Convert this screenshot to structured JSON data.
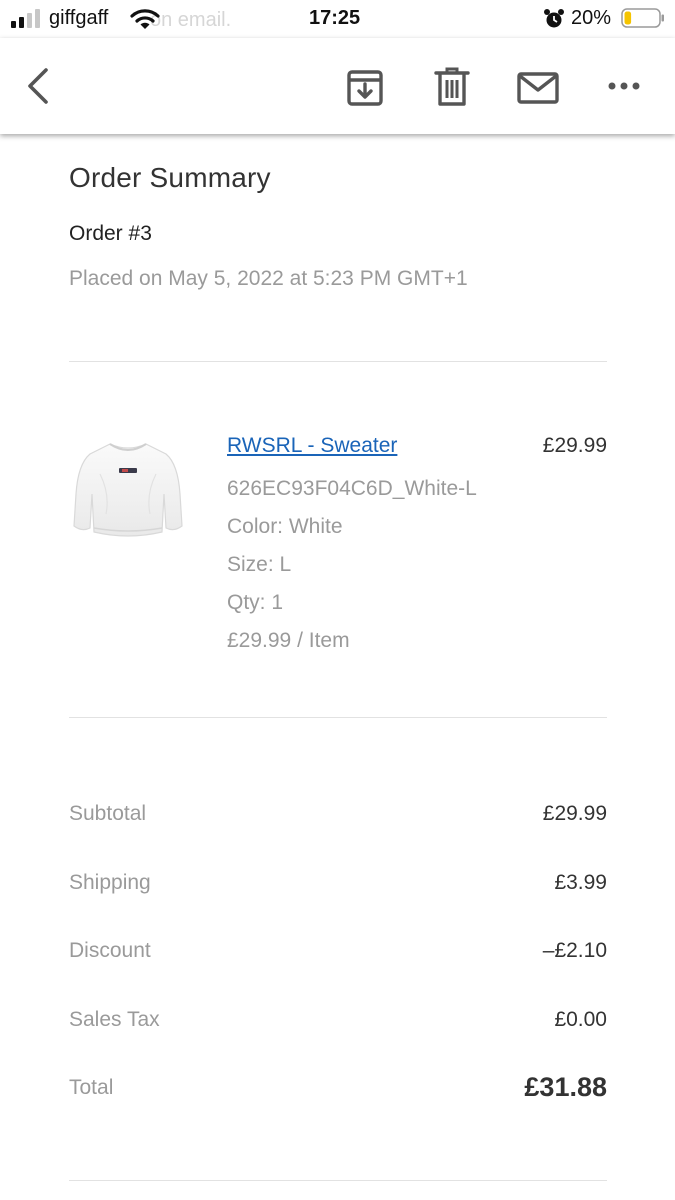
{
  "status_bar": {
    "carrier": "giffgaff",
    "ghost_text": "on email.",
    "time": "17:25",
    "battery_percent": "20%",
    "battery_level": 0.2,
    "signal_bars": 2,
    "icons": [
      "signal-icon",
      "wifi-icon",
      "alarm-icon",
      "battery-icon"
    ]
  },
  "toolbar": {
    "icons": [
      "back-icon",
      "archive-icon",
      "trash-icon",
      "mail-icon",
      "more-icon"
    ]
  },
  "order": {
    "title": "Order Summary",
    "number": "Order #3",
    "placed": "Placed on May 5, 2022 at 5:23 PM GMT+1"
  },
  "item": {
    "name": "RWSRL - Sweater",
    "price": "£29.99",
    "sku": "626EC93F04C6D_White-L",
    "color": "Color: White",
    "size": "Size: L",
    "qty": "Qty: 1",
    "unit_price": "£29.99 / Item"
  },
  "summary": {
    "subtotal_label": "Subtotal",
    "subtotal_value": "£29.99",
    "shipping_label": "Shipping",
    "shipping_value": "£3.99",
    "discount_label": "Discount",
    "discount_value": "–£2.10",
    "tax_label": "Sales Tax",
    "tax_value": "£0.00",
    "total_label": "Total",
    "total_value": "£31.88"
  },
  "colors": {
    "link": "#1a64b8",
    "muted_text": "#9a9a9a",
    "battery_fill": "#f5c400"
  }
}
